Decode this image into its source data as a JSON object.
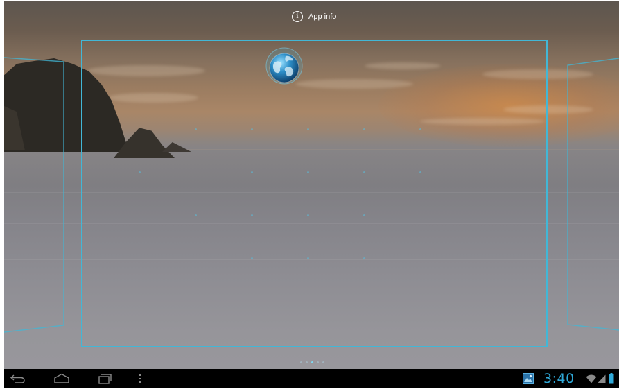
{
  "top_bar": {
    "app_info_label": "App info",
    "app_info_icon": "info-icon"
  },
  "home": {
    "dragged_app_icon": "browser-globe-icon",
    "page_count": 5,
    "active_page": 3
  },
  "system_bar": {
    "nav_buttons": [
      "back-icon",
      "home-icon",
      "recent-apps-icon",
      "menu-icon"
    ],
    "notification_icon": "gallery-notification-icon",
    "time": "3:40",
    "status_icons": [
      "wifi-icon",
      "signal-icon",
      "battery-icon"
    ]
  },
  "colors": {
    "accent": "#33b5e5",
    "frame": "#42b7d6",
    "navbar_background": "#000000"
  }
}
